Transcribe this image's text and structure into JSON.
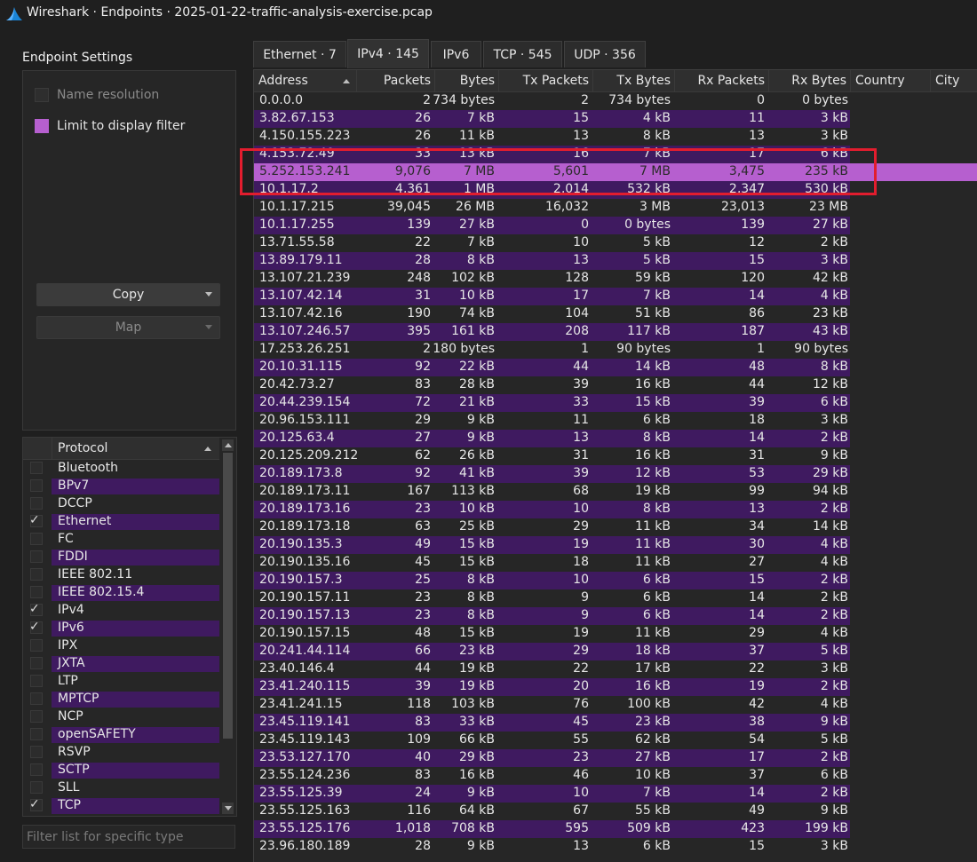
{
  "window": {
    "title": "Wireshark · Endpoints · 2025-01-22-traffic-analysis-exercise.pcap"
  },
  "settings": {
    "title": "Endpoint Settings",
    "name_resolution": {
      "label": "Name resolution",
      "checked": false,
      "enabled": false
    },
    "limit_to_display_filter": {
      "label": "Limit to display filter",
      "checked": true
    },
    "copy_label": "Copy",
    "map_label": "Map"
  },
  "protocol_list": {
    "header": "Protocol",
    "items": [
      {
        "label": "Bluetooth",
        "checked": false
      },
      {
        "label": "BPv7",
        "checked": false
      },
      {
        "label": "DCCP",
        "checked": false
      },
      {
        "label": "Ethernet",
        "checked": true
      },
      {
        "label": "FC",
        "checked": false
      },
      {
        "label": "FDDI",
        "checked": false
      },
      {
        "label": "IEEE 802.11",
        "checked": false
      },
      {
        "label": "IEEE 802.15.4",
        "checked": false
      },
      {
        "label": "IPv4",
        "checked": true
      },
      {
        "label": "IPv6",
        "checked": true
      },
      {
        "label": "IPX",
        "checked": false
      },
      {
        "label": "JXTA",
        "checked": false
      },
      {
        "label": "LTP",
        "checked": false
      },
      {
        "label": "MPTCP",
        "checked": false
      },
      {
        "label": "NCP",
        "checked": false
      },
      {
        "label": "openSAFETY",
        "checked": false
      },
      {
        "label": "RSVP",
        "checked": false
      },
      {
        "label": "SCTP",
        "checked": false
      },
      {
        "label": "SLL",
        "checked": false
      },
      {
        "label": "TCP",
        "checked": true
      }
    ],
    "filter_placeholder": "Filter list for specific type"
  },
  "tabs": [
    {
      "label": "Ethernet · 7",
      "active": false
    },
    {
      "label": "IPv4 · 145",
      "active": true
    },
    {
      "label": "IPv6",
      "active": false
    },
    {
      "label": "TCP · 545",
      "active": false
    },
    {
      "label": "UDP · 356",
      "active": false
    }
  ],
  "table": {
    "columns": [
      "Address",
      "Packets",
      "Bytes",
      "Tx Packets",
      "Tx Bytes",
      "Rx Packets",
      "Rx Bytes",
      "Country",
      "City"
    ],
    "selected_row": 4,
    "rows": [
      [
        "0.0.0.0",
        "2",
        "734 bytes",
        "2",
        "734 bytes",
        "0",
        "0 bytes"
      ],
      [
        "3.82.67.153",
        "26",
        "7 kB",
        "15",
        "4 kB",
        "11",
        "3 kB"
      ],
      [
        "4.150.155.223",
        "26",
        "11 kB",
        "13",
        "8 kB",
        "13",
        "3 kB"
      ],
      [
        "4.153.72.49",
        "33",
        "13 kB",
        "16",
        "7 kB",
        "17",
        "6 kB"
      ],
      [
        "5.252.153.241",
        "9,076",
        "7 MB",
        "5,601",
        "7 MB",
        "3,475",
        "235 kB"
      ],
      [
        "10.1.17.2",
        "4,361",
        "1 MB",
        "2,014",
        "532 kB",
        "2,347",
        "530 kB"
      ],
      [
        "10.1.17.215",
        "39,045",
        "26 MB",
        "16,032",
        "3 MB",
        "23,013",
        "23 MB"
      ],
      [
        "10.1.17.255",
        "139",
        "27 kB",
        "0",
        "0 bytes",
        "139",
        "27 kB"
      ],
      [
        "13.71.55.58",
        "22",
        "7 kB",
        "10",
        "5 kB",
        "12",
        "2 kB"
      ],
      [
        "13.89.179.11",
        "28",
        "8 kB",
        "13",
        "5 kB",
        "15",
        "3 kB"
      ],
      [
        "13.107.21.239",
        "248",
        "102 kB",
        "128",
        "59 kB",
        "120",
        "42 kB"
      ],
      [
        "13.107.42.14",
        "31",
        "10 kB",
        "17",
        "7 kB",
        "14",
        "4 kB"
      ],
      [
        "13.107.42.16",
        "190",
        "74 kB",
        "104",
        "51 kB",
        "86",
        "23 kB"
      ],
      [
        "13.107.246.57",
        "395",
        "161 kB",
        "208",
        "117 kB",
        "187",
        "43 kB"
      ],
      [
        "17.253.26.251",
        "2",
        "180 bytes",
        "1",
        "90 bytes",
        "1",
        "90 bytes"
      ],
      [
        "20.10.31.115",
        "92",
        "22 kB",
        "44",
        "14 kB",
        "48",
        "8 kB"
      ],
      [
        "20.42.73.27",
        "83",
        "28 kB",
        "39",
        "16 kB",
        "44",
        "12 kB"
      ],
      [
        "20.44.239.154",
        "72",
        "21 kB",
        "33",
        "15 kB",
        "39",
        "6 kB"
      ],
      [
        "20.96.153.111",
        "29",
        "9 kB",
        "11",
        "6 kB",
        "18",
        "3 kB"
      ],
      [
        "20.125.63.4",
        "27",
        "9 kB",
        "13",
        "8 kB",
        "14",
        "2 kB"
      ],
      [
        "20.125.209.212",
        "62",
        "26 kB",
        "31",
        "16 kB",
        "31",
        "9 kB"
      ],
      [
        "20.189.173.8",
        "92",
        "41 kB",
        "39",
        "12 kB",
        "53",
        "29 kB"
      ],
      [
        "20.189.173.11",
        "167",
        "113 kB",
        "68",
        "19 kB",
        "99",
        "94 kB"
      ],
      [
        "20.189.173.16",
        "23",
        "10 kB",
        "10",
        "8 kB",
        "13",
        "2 kB"
      ],
      [
        "20.189.173.18",
        "63",
        "25 kB",
        "29",
        "11 kB",
        "34",
        "14 kB"
      ],
      [
        "20.190.135.3",
        "49",
        "15 kB",
        "19",
        "11 kB",
        "30",
        "4 kB"
      ],
      [
        "20.190.135.16",
        "45",
        "15 kB",
        "18",
        "11 kB",
        "27",
        "4 kB"
      ],
      [
        "20.190.157.3",
        "25",
        "8 kB",
        "10",
        "6 kB",
        "15",
        "2 kB"
      ],
      [
        "20.190.157.11",
        "23",
        "8 kB",
        "9",
        "6 kB",
        "14",
        "2 kB"
      ],
      [
        "20.190.157.13",
        "23",
        "8 kB",
        "9",
        "6 kB",
        "14",
        "2 kB"
      ],
      [
        "20.190.157.15",
        "48",
        "15 kB",
        "19",
        "11 kB",
        "29",
        "4 kB"
      ],
      [
        "20.241.44.114",
        "66",
        "23 kB",
        "29",
        "18 kB",
        "37",
        "5 kB"
      ],
      [
        "23.40.146.4",
        "44",
        "19 kB",
        "22",
        "17 kB",
        "22",
        "3 kB"
      ],
      [
        "23.41.240.115",
        "39",
        "19 kB",
        "20",
        "16 kB",
        "19",
        "2 kB"
      ],
      [
        "23.41.241.15",
        "118",
        "103 kB",
        "76",
        "100 kB",
        "42",
        "4 kB"
      ],
      [
        "23.45.119.141",
        "83",
        "33 kB",
        "45",
        "23 kB",
        "38",
        "9 kB"
      ],
      [
        "23.45.119.143",
        "109",
        "66 kB",
        "55",
        "62 kB",
        "54",
        "5 kB"
      ],
      [
        "23.53.127.170",
        "40",
        "29 kB",
        "23",
        "27 kB",
        "17",
        "2 kB"
      ],
      [
        "23.55.124.236",
        "83",
        "16 kB",
        "46",
        "10 kB",
        "37",
        "6 kB"
      ],
      [
        "23.55.125.39",
        "24",
        "9 kB",
        "10",
        "7 kB",
        "14",
        "2 kB"
      ],
      [
        "23.55.125.163",
        "116",
        "64 kB",
        "67",
        "55 kB",
        "49",
        "9 kB"
      ],
      [
        "23.55.125.176",
        "1,018",
        "708 kB",
        "595",
        "509 kB",
        "423",
        "199 kB"
      ],
      [
        "23.96.180.189",
        "28",
        "9 kB",
        "13",
        "6 kB",
        "15",
        "3 kB"
      ]
    ]
  },
  "colors": {
    "accent": "#b65fcf",
    "alt_row": "#3f1a60",
    "annotation": "#e21d2e"
  }
}
